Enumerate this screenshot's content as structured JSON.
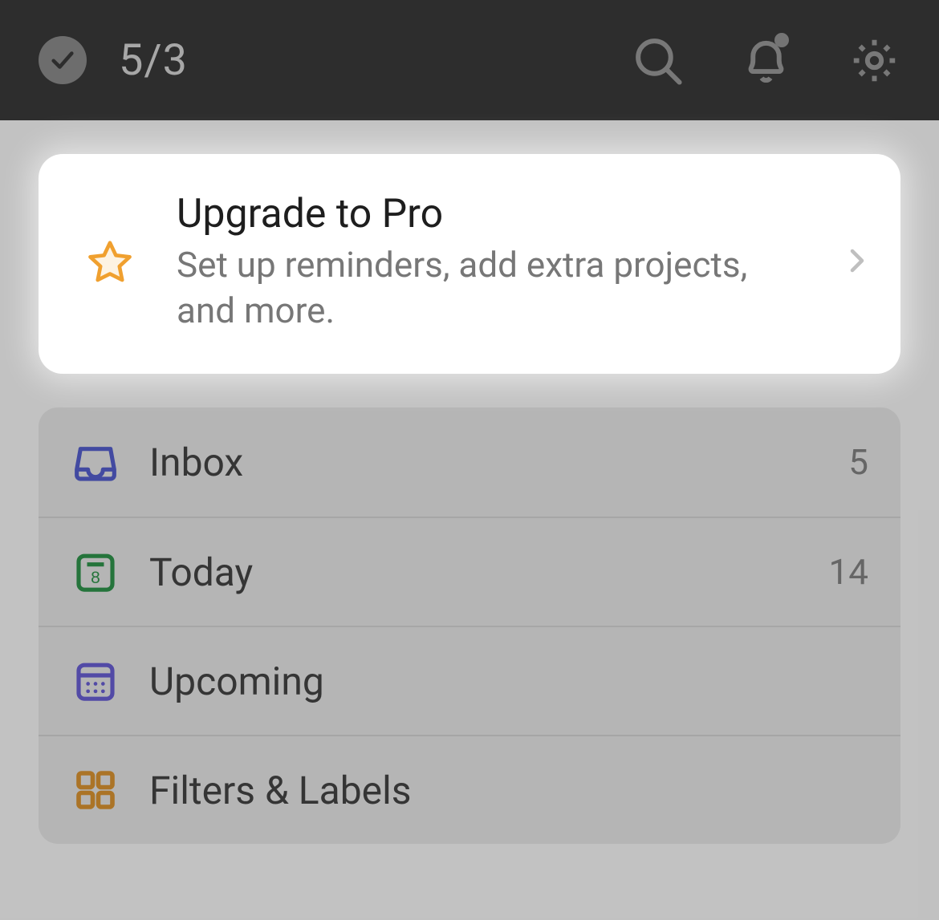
{
  "header": {
    "progress": "5/3"
  },
  "promo": {
    "title": "Upgrade to Pro",
    "subtitle": "Set up reminders, add extra projects, and more."
  },
  "nav": {
    "items": [
      {
        "label": "Inbox",
        "count": "5"
      },
      {
        "label": "Today",
        "count": "14"
      },
      {
        "label": "Upcoming",
        "count": ""
      },
      {
        "label": "Filters & Labels",
        "count": ""
      }
    ]
  }
}
